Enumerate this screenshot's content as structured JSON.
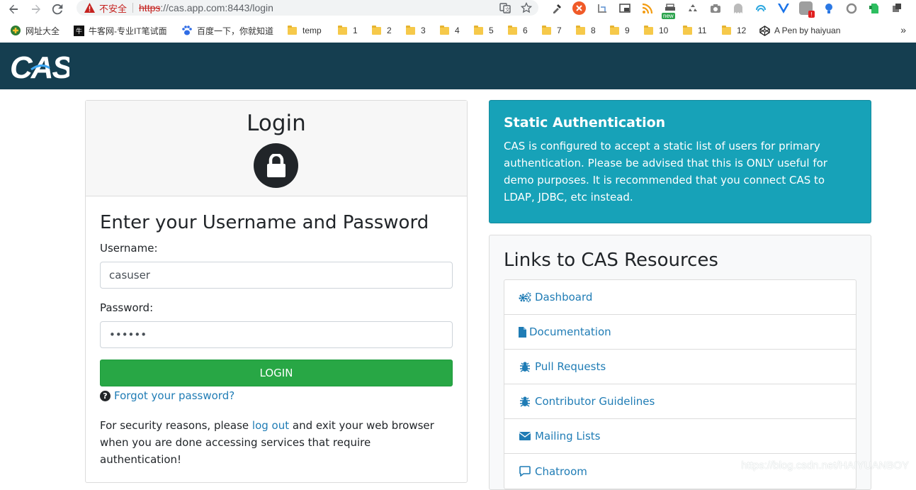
{
  "browser": {
    "security_label": "不安全",
    "url_scheme": "https",
    "url_rest": "://cas.app.com:8443/login",
    "ext_new_badge": "new",
    "ext_alert_badge": "!"
  },
  "bookmarks": [
    {
      "label": "网址大全"
    },
    {
      "label": "牛客网-专业IT笔试面"
    },
    {
      "label": "百度一下，你就知道"
    },
    {
      "label": "temp"
    },
    {
      "label": "1"
    },
    {
      "label": "2"
    },
    {
      "label": "3"
    },
    {
      "label": "4"
    },
    {
      "label": "5"
    },
    {
      "label": "6"
    },
    {
      "label": "7"
    },
    {
      "label": "8"
    },
    {
      "label": "9"
    },
    {
      "label": "10"
    },
    {
      "label": "11"
    },
    {
      "label": "12"
    },
    {
      "label": "A Pen by haiyuan"
    }
  ],
  "bookmarks_more": "»",
  "header": {
    "logo_text": "CAS",
    "brand_color": "#153e50"
  },
  "login": {
    "title": "Login",
    "form_heading": "Enter your Username and Password",
    "username_label": "Username:",
    "username_value": "casuser",
    "password_label": "Password:",
    "password_value": "123456",
    "submit_label": "LOGIN",
    "forgot_label": "Forgot your password?",
    "security_before": "For security reasons, please ",
    "security_link": "log out",
    "security_after": " and exit your web browser when you are done accessing services that require authentication!"
  },
  "static_auth": {
    "title": "Static Authentication",
    "text": "CAS is configured to accept a static list of users for primary authentication. Please be advised that this is ONLY useful for demo purposes. It is recommended that you connect CAS to LDAP, JDBC, etc instead.",
    "color": "#17a2b8"
  },
  "resources": {
    "title": "Links to CAS Resources",
    "items": [
      {
        "label": "Dashboard",
        "icon": "cogs-icon"
      },
      {
        "label": "Documentation",
        "icon": "file-icon"
      },
      {
        "label": "Pull Requests",
        "icon": "bug-icon"
      },
      {
        "label": "Contributor Guidelines",
        "icon": "bug-icon"
      },
      {
        "label": "Mailing Lists",
        "icon": "envelope-icon"
      },
      {
        "label": "Chatroom",
        "icon": "chat-icon"
      }
    ]
  },
  "watermark": "https://blog.csdn.net/HAIYUANBOY"
}
